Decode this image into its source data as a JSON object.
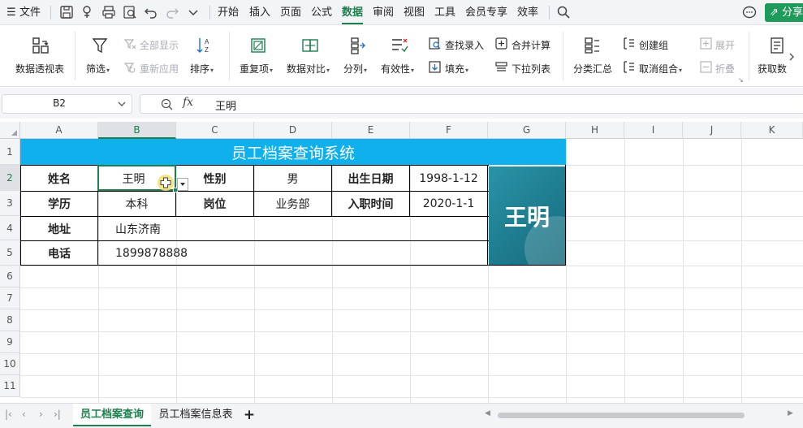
{
  "menubar": {
    "hamburger": "☰",
    "file": "文件",
    "tabs": [
      {
        "label": "开始"
      },
      {
        "label": "插入"
      },
      {
        "label": "页面"
      },
      {
        "label": "公式"
      },
      {
        "label": "数据"
      },
      {
        "label": "审阅"
      },
      {
        "label": "视图"
      },
      {
        "label": "工具"
      },
      {
        "label": "会员专享"
      },
      {
        "label": "效率"
      }
    ],
    "active_tab": "数据",
    "share": "分享"
  },
  "ribbon": {
    "pivot": "数据透视表",
    "filter": "筛选",
    "show_all": "全部显示",
    "reapply": "重新应用",
    "sort": "排序",
    "duplicates": "重复项",
    "compare": "数据对比",
    "split": "分列",
    "validity": "有效性",
    "find_entry": "查找录入",
    "fill": "填充",
    "consolidate": "合并计算",
    "dropdown_list": "下拉列表",
    "subtotal": "分类汇总",
    "create_group": "创建组",
    "ungroup": "取消组合",
    "expand": "展开",
    "collapse": "折叠",
    "get_data": "获取数"
  },
  "formula_bar": {
    "name_box": "B2",
    "fx": "fx",
    "value": "王明"
  },
  "grid": {
    "columns": [
      "A",
      "B",
      "C",
      "D",
      "E",
      "F",
      "G",
      "H",
      "I",
      "J",
      "K"
    ],
    "rows": [
      "1",
      "2",
      "3",
      "4",
      "5",
      "6",
      "7",
      "8",
      "9",
      "10",
      "11"
    ],
    "selected_column": "B",
    "selected_row": "2"
  },
  "form": {
    "title": "员工档案查询系统",
    "name_label": "姓名",
    "name_value": "王明",
    "gender_label": "性别",
    "gender_value": "男",
    "dob_label": "出生日期",
    "dob_value": "1998-1-12",
    "edu_label": "学历",
    "edu_value": "本科",
    "post_label": "岗位",
    "post_value": "业务部",
    "hire_label": "入职时间",
    "hire_value": "2020-1-1",
    "addr_label": "地址",
    "addr_value": "山东济南",
    "phone_label": "电话",
    "phone_value": "1899878888",
    "photo_text": "王明"
  },
  "sheets": {
    "tabs": [
      {
        "label": "员工档案查询"
      },
      {
        "label": "员工档案信息表"
      }
    ],
    "active": "员工档案查询",
    "add": "+"
  },
  "colors": {
    "accent": "#1c7f4d",
    "title_band": "#0fb0ec",
    "photo": "#1e7c8f"
  }
}
